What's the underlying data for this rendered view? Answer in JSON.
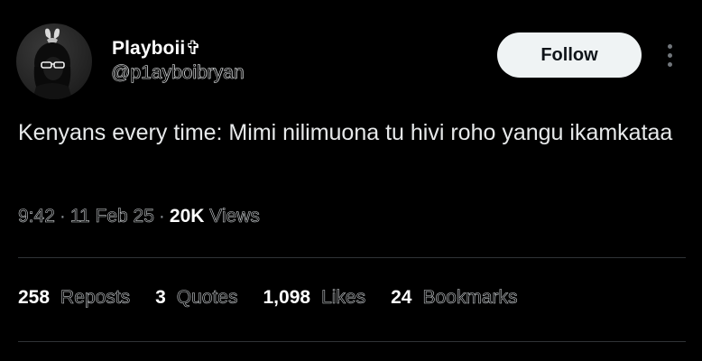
{
  "author": {
    "display_name": "Playboii✞",
    "handle": "@p1ayboibryan"
  },
  "actions": {
    "follow_label": "Follow"
  },
  "tweet": {
    "text": "Kenyans every time: Mimi nilimuona tu hivi roho yangu ikamkataa",
    "time": "9:42",
    "date": "11 Feb 25",
    "views_count": "20K",
    "views_label": "Views"
  },
  "stats": {
    "reposts": {
      "count": "258",
      "label": "Reposts"
    },
    "quotes": {
      "count": "3",
      "label": "Quotes"
    },
    "likes": {
      "count": "1,098",
      "label": "Likes"
    },
    "bookmarks": {
      "count": "24",
      "label": "Bookmarks"
    }
  },
  "icons": {
    "more": "more-vertical-icon",
    "avatar": "profile-avatar"
  },
  "colors": {
    "background": "#000000",
    "follow_button_bg": "#eff3f4",
    "secondary_text": "#71767b",
    "divider": "#2f3336"
  }
}
